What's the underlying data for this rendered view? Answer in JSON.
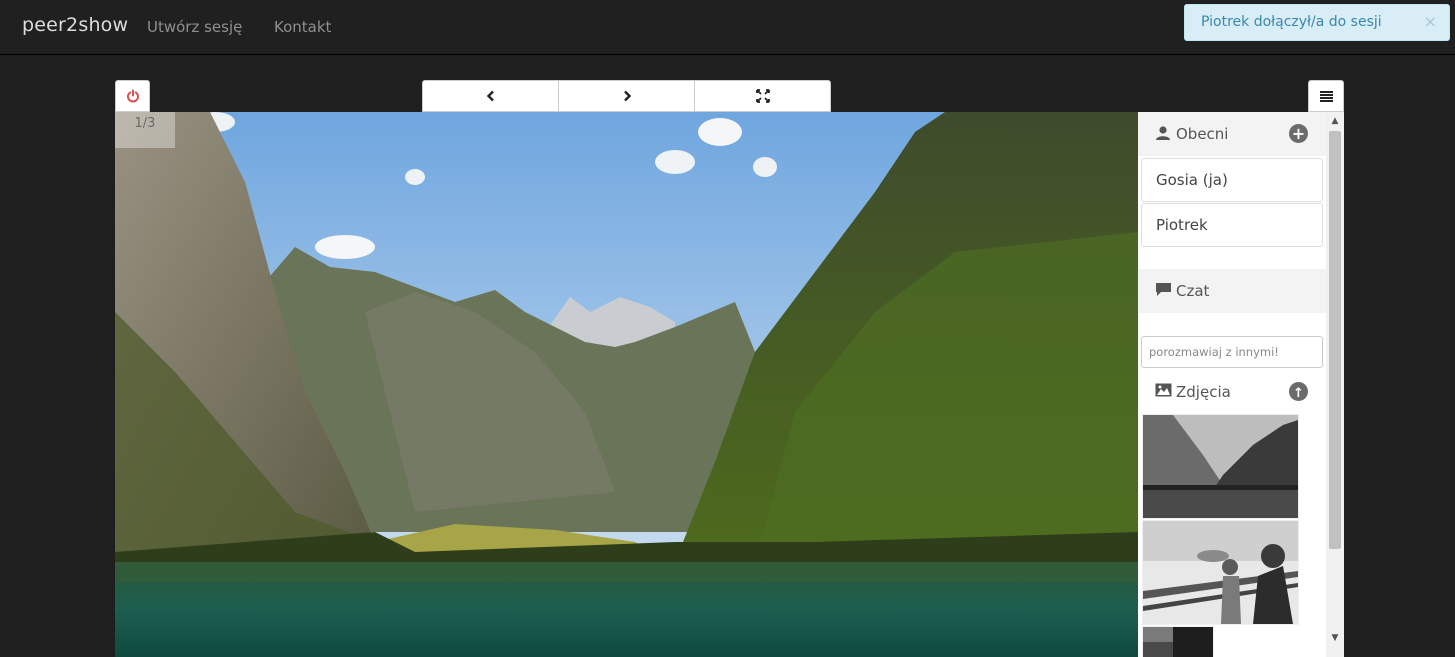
{
  "navbar": {
    "brand": "peer2show",
    "links": [
      "Utwórz sesję",
      "Kontakt"
    ]
  },
  "alert": {
    "message": "Piotrek dołączył/a do sesji",
    "close": "×"
  },
  "viewer": {
    "counter": "1/3",
    "controls": {
      "power_icon": "power-icon",
      "prev_icon": "chevron-left-icon",
      "next_icon": "chevron-right-icon",
      "fullscreen_icon": "fullscreen-icon",
      "menu_icon": "list-icon"
    }
  },
  "sidebar": {
    "present": {
      "title": "Obecni",
      "icon": "user-icon",
      "add_icon": "plus-circle-icon",
      "users": [
        "Gosia (ja)",
        "Piotrek"
      ]
    },
    "chat": {
      "title": "Czat",
      "icon": "comment-icon",
      "placeholder": "porozmawiaj z innymi!"
    },
    "photos": {
      "title": "Zdjęcia",
      "icon": "picture-icon",
      "upload_icon": "upload-circle-icon"
    }
  },
  "colors": {
    "background": "#1f1f1f",
    "navbar": "#202020",
    "alert_bg": "#d9edf7",
    "alert_text": "#3a87ad",
    "power_red": "#d9534f"
  }
}
